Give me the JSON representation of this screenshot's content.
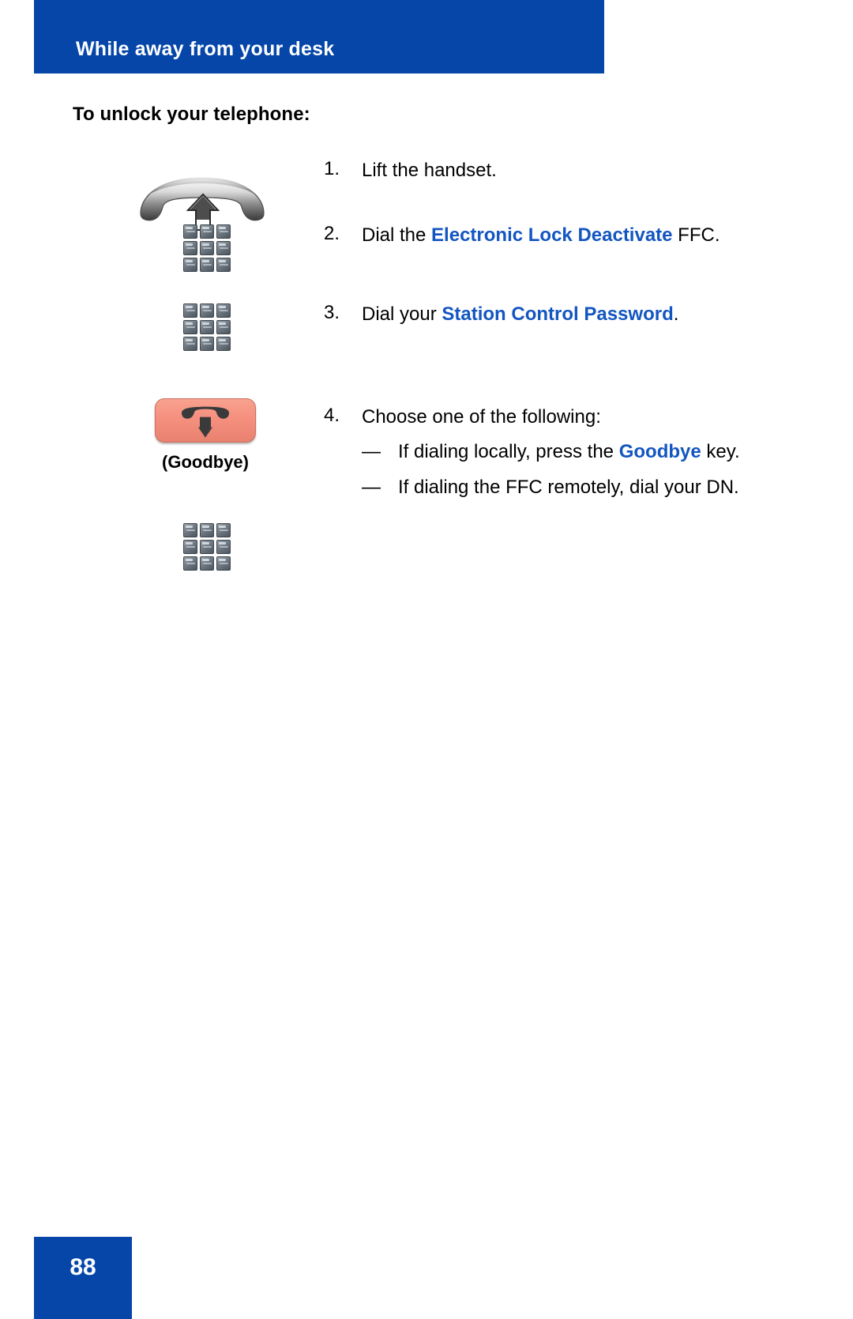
{
  "header": {
    "title": "While away from your desk",
    "band_color": "#0546A8"
  },
  "section": {
    "heading": "To unlock your telephone:"
  },
  "accent_color": "#1356C0",
  "steps": [
    {
      "number": "1.",
      "icon": "handset-lift-icon",
      "text_before": "Lift the handset.",
      "highlight": "",
      "text_after": ""
    },
    {
      "number": "2.",
      "icon": "dialpad-icon",
      "text_before": "Dial the ",
      "highlight": "Electronic Lock Deactivate",
      "text_after": " FFC."
    },
    {
      "number": "3.",
      "icon": "dialpad-icon",
      "text_before": "Dial your ",
      "highlight": "Station Control Password",
      "text_after": "."
    },
    {
      "number": "4.",
      "icon": "goodbye-key-icon",
      "text_before": "Choose one of the following:",
      "highlight": "",
      "text_after": ""
    }
  ],
  "step4_sublist": [
    {
      "dash": "—",
      "text_before": "If dialing locally, press the ",
      "highlight": "Goodbye",
      "text_after": " key."
    },
    {
      "dash": "—",
      "text_before": "If dialing the FFC remotely, dial your DN.",
      "highlight": "",
      "text_after": ""
    }
  ],
  "goodbye_key": {
    "label": "(Goodbye)",
    "key_color": "#F69180",
    "icon": "handset-hangup-icon"
  },
  "footer": {
    "page_number": "88",
    "band_color": "#0546A8"
  }
}
